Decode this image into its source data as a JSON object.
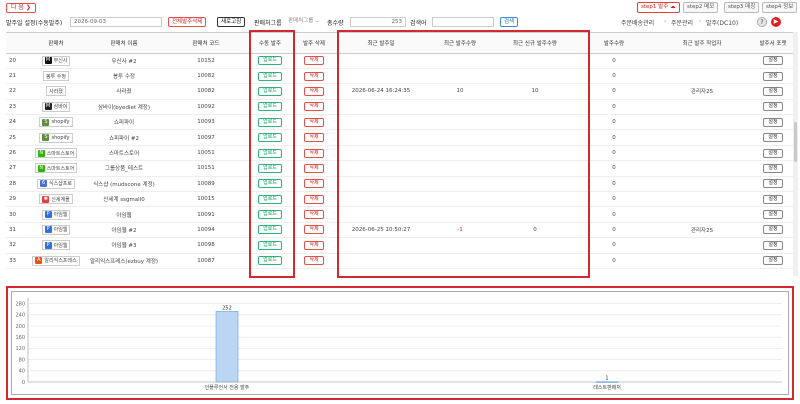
{
  "header": {
    "next_button": "다 음 ❯",
    "steps": [
      {
        "label": "step1 발주 ☁",
        "active": true
      },
      {
        "label": "step2 메모",
        "active": false
      },
      {
        "label": "step3 매칭",
        "active": false
      },
      {
        "label": "step4 정보",
        "active": false
      }
    ]
  },
  "toolbar": {
    "title": "발주일 설정(수동발주)",
    "date": "2026-09-03",
    "delete_all": "전체발주삭제",
    "refresh": "새로고침",
    "vendor_group_label": "판매처그룹",
    "vendor_group_value": "판매처그룹",
    "total_label": "총수량",
    "total_value": "253",
    "search_label": "검색어",
    "search_value": "",
    "search_button": "검색",
    "breadcrumb": [
      "주문배송관리",
      "주문관리",
      "발주(DC10)"
    ]
  },
  "table": {
    "headers": [
      "",
      "판매처",
      "판매처 이름",
      "판매처 코드",
      "수동 발주",
      "발주 삭제",
      "최근 발주일",
      "최근 발주수량",
      "최근 신규 발주수량",
      "발주수량",
      "최근 발주 작업자",
      "발주서 포맷"
    ],
    "upload_label": "업로드",
    "delete_label": "삭제",
    "format_label": "설정",
    "rows": [
      {
        "no": "20",
        "vendor": "무신사",
        "logo": "M",
        "logo_color": "#111111",
        "name": "무신사 #2",
        "code": "10152",
        "date": "",
        "qty": "",
        "new_qty": "",
        "order_qty": "0",
        "worker": ""
      },
      {
        "no": "21",
        "vendor": "봉투 수정",
        "logo": "",
        "logo_color": "",
        "name": "봉투 수정",
        "code": "10082",
        "date": "",
        "qty": "",
        "new_qty": "",
        "order_qty": "0",
        "worker": ""
      },
      {
        "no": "22",
        "vendor": "사라졌",
        "logo": "",
        "logo_color": "",
        "name": "사라졌",
        "code": "10082",
        "date": "2026-06-24 16:24:35",
        "qty": "10",
        "new_qty": "10",
        "order_qty": "0",
        "worker": "관리자25"
      },
      {
        "no": "23",
        "vendor": "삼바이",
        "logo": "M",
        "logo_color": "#222222",
        "name": "삼바이(byediet 계정)",
        "code": "10092",
        "date": "",
        "qty": "",
        "new_qty": "",
        "order_qty": "0",
        "worker": ""
      },
      {
        "no": "24",
        "vendor": "shopify",
        "logo": "S",
        "logo_color": "#5e8e3e",
        "name": "쇼피파이",
        "code": "10093",
        "date": "",
        "qty": "",
        "new_qty": "",
        "order_qty": "0",
        "worker": ""
      },
      {
        "no": "25",
        "vendor": "shopify",
        "logo": "S",
        "logo_color": "#5e8e3e",
        "name": "쇼피파이 #2",
        "code": "10097",
        "date": "",
        "qty": "",
        "new_qty": "",
        "order_qty": "0",
        "worker": ""
      },
      {
        "no": "26",
        "vendor": "스마트스토어",
        "logo": "N",
        "logo_color": "#2db400",
        "name": "스마트스토어",
        "code": "10051",
        "date": "",
        "qty": "",
        "new_qty": "",
        "order_qty": "0",
        "worker": ""
      },
      {
        "no": "27",
        "vendor": "스마트스토어",
        "logo": "N",
        "logo_color": "#2db400",
        "name": "그룹상품_테스트",
        "code": "10151",
        "date": "",
        "qty": "",
        "new_qty": "",
        "order_qty": "0",
        "worker": ""
      },
      {
        "no": "28",
        "vendor": "식스샵프로",
        "logo": "6",
        "logo_color": "#4a6fd8",
        "name": "식스샵 (mudscone 계정)",
        "code": "10089",
        "date": "",
        "qty": "",
        "new_qty": "",
        "order_qty": "0",
        "worker": ""
      },
      {
        "no": "29",
        "vendor": "신세계몰",
        "logo": "✽",
        "logo_color": "#e04040",
        "name": "신세계 ssgmall0",
        "code": "10015",
        "date": "",
        "qty": "",
        "new_qty": "",
        "order_qty": "0",
        "worker": ""
      },
      {
        "no": "30",
        "vendor": "아임웹",
        "logo": "P",
        "logo_color": "#2f6fe0",
        "name": "아임웹",
        "code": "10091",
        "date": "",
        "qty": "",
        "new_qty": "",
        "order_qty": "0",
        "worker": ""
      },
      {
        "no": "31",
        "vendor": "아임웹",
        "logo": "P",
        "logo_color": "#2f6fe0",
        "name": "아임웹 #2",
        "code": "10094",
        "date": "2026-06-25 10:50:27",
        "qty": "-1",
        "new_qty": "0",
        "order_qty": "0",
        "worker": "관리자25"
      },
      {
        "no": "32",
        "vendor": "아임웹",
        "logo": "P",
        "logo_color": "#2f6fe0",
        "name": "아임웹 #3",
        "code": "10098",
        "date": "",
        "qty": "",
        "new_qty": "",
        "order_qty": "0",
        "worker": ""
      },
      {
        "no": "33",
        "vendor": "알리익스프레스",
        "logo": "A",
        "logo_color": "#e8531a",
        "name": "알리익스프레스(ezbuy 계정)",
        "code": "10087",
        "date": "",
        "qty": "",
        "new_qty": "",
        "order_qty": "0",
        "worker": ""
      }
    ]
  },
  "chart_data": {
    "type": "bar",
    "categories": [
      "인플루언서 전용 발주",
      "테스트판매처"
    ],
    "values": [
      252,
      1
    ],
    "ylim": [
      0,
      300
    ],
    "yticks": [
      0,
      40,
      80,
      120,
      160,
      200,
      240,
      280
    ],
    "grid": true,
    "bar_color": "#b9d6f2"
  }
}
